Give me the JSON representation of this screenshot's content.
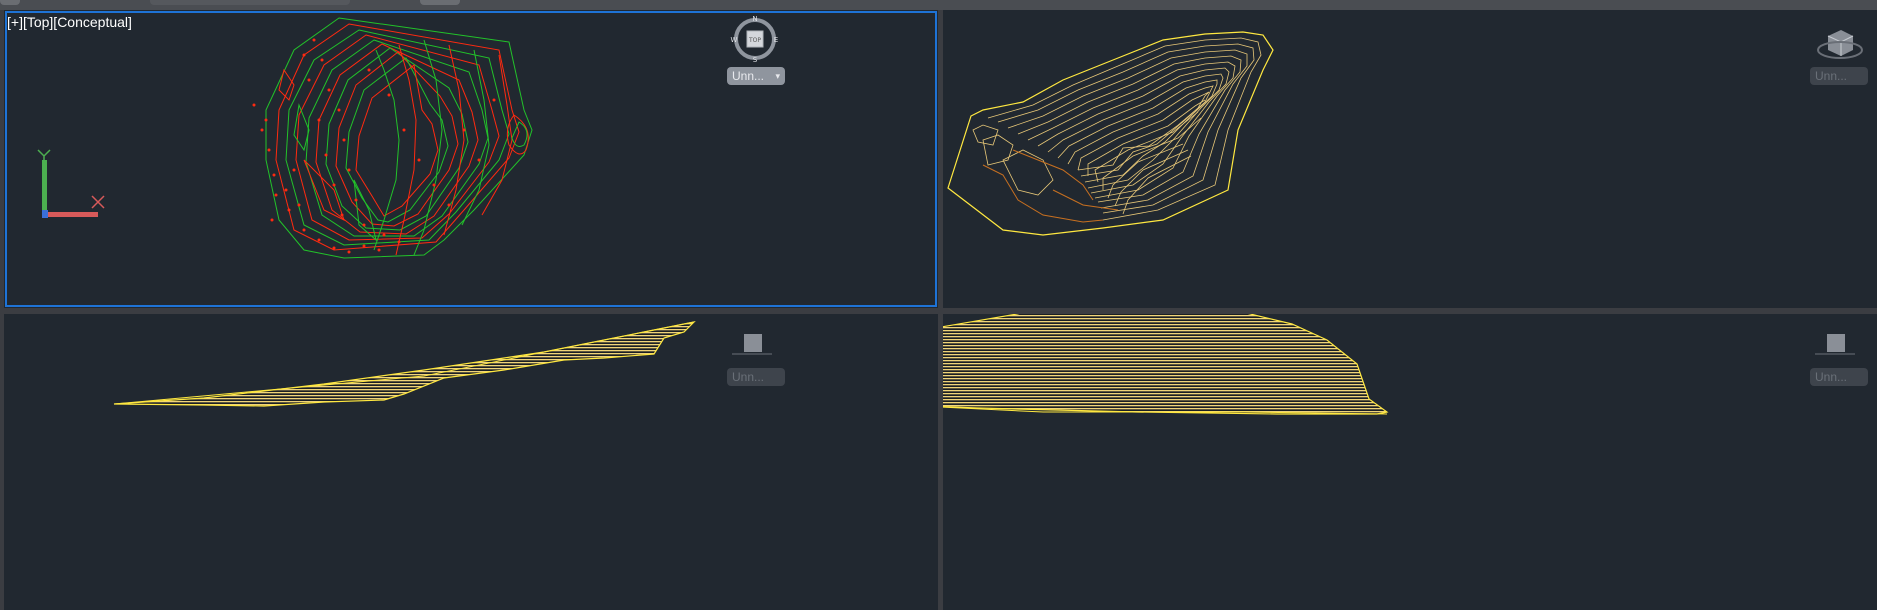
{
  "viewports": {
    "top_left": {
      "label": "[+][Top][Conceptual]",
      "compass": {
        "n": "N",
        "s": "S",
        "e": "E",
        "w": "W",
        "center": "TOP"
      },
      "visual_style_button": "Unn..."
    },
    "top_right": {
      "visual_style_button": "Unn..."
    },
    "bottom_left": {
      "visual_style_button": "Unn..."
    },
    "bottom_right": {
      "visual_style_button": "Unn..."
    }
  },
  "ucs": {
    "x_label": "X",
    "y_label": "Y"
  },
  "colors": {
    "background": "#212830",
    "active_border": "#1e73d6",
    "contour_red": "#ff2a10",
    "contour_green": "#22c22a",
    "contour_yellow": "#ffe840",
    "contour_orange": "#c87020"
  }
}
